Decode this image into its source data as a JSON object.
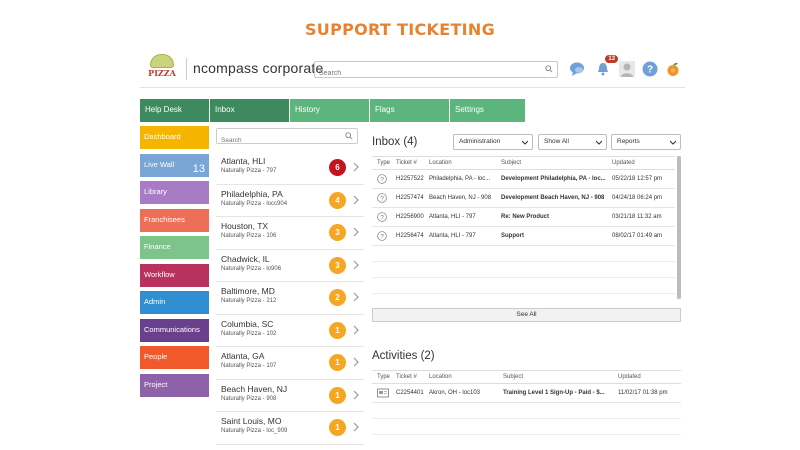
{
  "page_title": "SUPPORT TICKETING",
  "header": {
    "logo_text": "PIZZA",
    "company": "ncompass corporate",
    "search_placeholder": "Search",
    "notifications_count": "13"
  },
  "nav": {
    "tabs": [
      "Help Desk",
      "Inbox",
      "History",
      "Flags",
      "Settings"
    ]
  },
  "sidebar": {
    "items": [
      {
        "label": "Dashboard",
        "color": "#f5b400"
      },
      {
        "label": "Live Wall",
        "color": "#7aa6d6",
        "count": "13"
      },
      {
        "label": "Library",
        "color": "#a87cc4"
      },
      {
        "label": "Franchisees",
        "color": "#ee6f57"
      },
      {
        "label": "Finance",
        "color": "#7cc48a"
      },
      {
        "label": "Workflow",
        "color": "#b9315f"
      },
      {
        "label": "Admin",
        "color": "#2f8fd0"
      },
      {
        "label": "Communications",
        "color": "#6a3f8c"
      },
      {
        "label": "People",
        "color": "#f1592a"
      },
      {
        "label": "Project",
        "color": "#8e62a8"
      }
    ]
  },
  "locations": {
    "search_placeholder": "Search",
    "items": [
      {
        "name": "Atlanta, HLI",
        "sub": "Naturally Pizza - 797",
        "count": "6",
        "color": "#c4141f"
      },
      {
        "name": "Philadelphia, PA",
        "sub": "Naturally Pizza - locc904",
        "count": "4",
        "color": "#f5a623"
      },
      {
        "name": "Houston, TX",
        "sub": "Naturally Pizza - 106",
        "count": "3",
        "color": "#f5a623"
      },
      {
        "name": "Chadwick, IL",
        "sub": "Naturally Pizza - lo906",
        "count": "3",
        "color": "#f5a623"
      },
      {
        "name": "Baltimore, MD",
        "sub": "Naturally Pizza - 212",
        "count": "2",
        "color": "#f5a623"
      },
      {
        "name": "Columbia, SC",
        "sub": "Naturally Pizza - 102",
        "count": "1",
        "color": "#f5a623"
      },
      {
        "name": "Atlanta, GA",
        "sub": "Naturally Pizza - 107",
        "count": "1",
        "color": "#f5a623"
      },
      {
        "name": "Beach Haven, NJ",
        "sub": "Naturally Pizza - 908",
        "count": "1",
        "color": "#f5a623"
      },
      {
        "name": "Saint Louis, MO",
        "sub": "Naturally Pizza - loc_909",
        "count": "1",
        "color": "#f5a623"
      }
    ]
  },
  "inbox": {
    "title": "Inbox (4)",
    "filter_admin": "Administration",
    "filter_show": "Show All",
    "filter_reports": "Reports",
    "columns": [
      "Type",
      "Ticket #",
      "Location",
      "Subject",
      "Updated"
    ],
    "rows": [
      {
        "ticket": "H2257522",
        "location": "Philadelphia, PA - loc...",
        "subject": "Development Philadelphia, PA - loc...",
        "updated": "05/22/18 12:57 pm"
      },
      {
        "ticket": "H2257474",
        "location": "Beach Haven, NJ - 908",
        "subject": "Development Beach Haven, NJ - 908",
        "updated": "04/24/18 06:24 pm"
      },
      {
        "ticket": "H2256900",
        "location": "Atlanta, HLI - 797",
        "subject": "Re: New Product",
        "updated": "03/21/18 11:32 am"
      },
      {
        "ticket": "H2256474",
        "location": "Atlanta, HLI - 797",
        "subject": "Support",
        "updated": "08/02/17 01:49 am"
      }
    ],
    "see_all": "See All"
  },
  "activities": {
    "title": "Activities (2)",
    "columns": [
      "Type",
      "Ticket #",
      "Location",
      "Subject",
      "Updated"
    ],
    "rows": [
      {
        "ticket": "C2254401",
        "location": "Akron, OH - loc103",
        "subject": "Training Level 1 Sign-Up - Paid - $...",
        "updated": "11/02/17 01:38 pm"
      }
    ]
  }
}
